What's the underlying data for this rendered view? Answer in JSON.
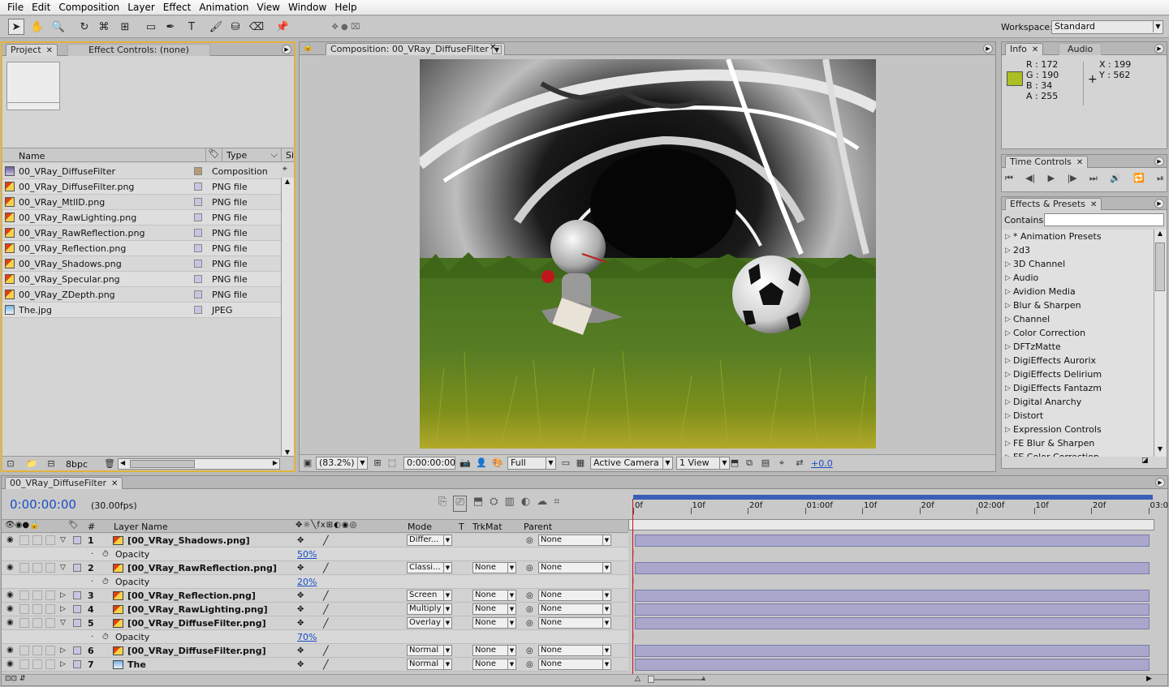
{
  "menu": [
    "File",
    "Edit",
    "Composition",
    "Layer",
    "Effect",
    "Animation",
    "View",
    "Window",
    "Help"
  ],
  "workspace": {
    "label": "Workspace:",
    "value": "Standard"
  },
  "project_panel": {
    "tabs": [
      {
        "label": "Project"
      },
      {
        "label": "Effect Controls: (none)"
      }
    ],
    "columns": {
      "name": "Name",
      "type": "Type",
      "size": "Si"
    },
    "items": [
      {
        "name": "00_VRay_DiffuseFilter",
        "type": "Composition",
        "kind": "comp",
        "swatch": "#b59c78"
      },
      {
        "name": "00_VRay_DiffuseFilter.png",
        "type": "PNG file",
        "kind": "png",
        "swatch": "#c7c6e2"
      },
      {
        "name": "00_VRay_MtlID.png",
        "type": "PNG file",
        "kind": "png",
        "swatch": "#c7c6e2"
      },
      {
        "name": "00_VRay_RawLighting.png",
        "type": "PNG file",
        "kind": "png",
        "swatch": "#c7c6e2"
      },
      {
        "name": "00_VRay_RawReflection.png",
        "type": "PNG file",
        "kind": "png",
        "swatch": "#c7c6e2"
      },
      {
        "name": "00_VRay_Reflection.png",
        "type": "PNG file",
        "kind": "png",
        "swatch": "#c7c6e2"
      },
      {
        "name": "00_VRay_Shadows.png",
        "type": "PNG file",
        "kind": "png",
        "swatch": "#c7c6e2"
      },
      {
        "name": "00_VRay_Specular.png",
        "type": "PNG file",
        "kind": "png",
        "swatch": "#c7c6e2"
      },
      {
        "name": "00_VRay_ZDepth.png",
        "type": "PNG file",
        "kind": "png",
        "swatch": "#c7c6e2"
      },
      {
        "name": "The.jpg",
        "type": "JPEG",
        "kind": "jpg",
        "swatch": "#c7c6e2"
      }
    ],
    "bpc": "8bpc"
  },
  "comp_panel": {
    "tab": "Composition: 00_VRay_DiffuseFilter",
    "zoom": "(83.2%)",
    "timecode": "0:00:00:00",
    "resolution": "Full",
    "camera": "Active Camera",
    "views": "1 View",
    "exposure": "+0.0"
  },
  "info_panel": {
    "tabs": [
      {
        "label": "Info"
      },
      {
        "label": "Audio"
      }
    ],
    "r": "R : 172",
    "g": "G : 190",
    "b": "B : 34",
    "a": "A : 255",
    "x": "X : 199",
    "y": "Y : 562",
    "color": "#acbe22"
  },
  "time_controls": {
    "tab": "Time Controls"
  },
  "effects_panel": {
    "tab": "Effects & Presets",
    "contains_label": "Contains:",
    "items": [
      "* Animation Presets",
      "2d3",
      "3D Channel",
      "Audio",
      "Avidion Media",
      "Blur & Sharpen",
      "Channel",
      "Color Correction",
      "DFTzMatte",
      "DigiEffects Aurorix",
      "DigiEffects Delirium",
      "DigiEffects Fantazm",
      "Digital Anarchy",
      "Distort",
      "Expression Controls",
      "FE Blur & Sharpen",
      "FE Color Correction"
    ]
  },
  "timeline": {
    "tab": "00_VRay_DiffuseFilter",
    "timecode": "0:00:00:00",
    "fps": "(30.00fps)",
    "headers": {
      "num": "#",
      "name": "Layer Name",
      "mode": "Mode",
      "t": "T",
      "trkmat": "TrkMat",
      "parent": "Parent"
    },
    "ruler": [
      "0f",
      "10f",
      "20f",
      "01:00f",
      "10f",
      "20f",
      "02:00f",
      "10f",
      "20f",
      "03:0"
    ],
    "layers": [
      {
        "num": "1",
        "name": "[00_VRay_Shadows.png]",
        "mode": "Differ...",
        "trkmat": "",
        "parent": "None",
        "expanded": true,
        "opacity_label": "Opacity",
        "opacity": "50%"
      },
      {
        "num": "2",
        "name": "[00_VRay_RawReflection.png]",
        "mode": "Classi...",
        "trkmat": "None",
        "parent": "None",
        "expanded": true,
        "opacity_label": "Opacity",
        "opacity": "20%"
      },
      {
        "num": "3",
        "name": "[00_VRay_Reflection.png]",
        "mode": "Screen",
        "trkmat": "None",
        "parent": "None",
        "expanded": false
      },
      {
        "num": "4",
        "name": "[00_VRay_RawLighting.png]",
        "mode": "Multiply",
        "trkmat": "None",
        "parent": "None",
        "expanded": false
      },
      {
        "num": "5",
        "name": "[00_VRay_DiffuseFilter.png]",
        "mode": "Overlay",
        "trkmat": "None",
        "parent": "None",
        "expanded": true,
        "opacity_label": "Opacity",
        "opacity": "70%"
      },
      {
        "num": "6",
        "name": "[00_VRay_DiffuseFilter.png]",
        "mode": "Normal",
        "trkmat": "None",
        "parent": "None",
        "expanded": false
      },
      {
        "num": "7",
        "name": "The",
        "mode": "Normal",
        "trkmat": "None",
        "parent": "None",
        "expanded": false
      }
    ]
  }
}
